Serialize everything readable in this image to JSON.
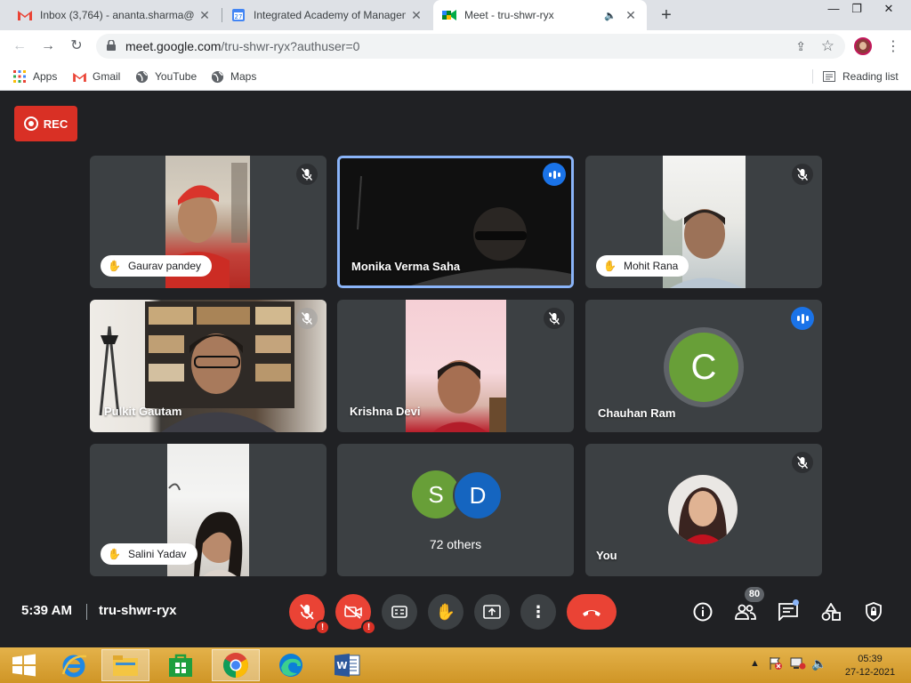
{
  "browser": {
    "tabs": [
      {
        "title": "Inbox (3,764) - ananta.sharma@i",
        "favicon": "gmail-icon"
      },
      {
        "title": "Integrated Academy of Managem",
        "favicon": "calendar-icon"
      },
      {
        "title": "Meet - tru-shwr-ryx",
        "favicon": "meet-icon",
        "active": true
      }
    ],
    "url_host": "meet.google.com",
    "url_path": "/tru-shwr-ryx?authuser=0",
    "bookmarks": [
      {
        "label": "Apps",
        "icon": "apps-grid-icon"
      },
      {
        "label": "Gmail",
        "icon": "gmail-icon"
      },
      {
        "label": "YouTube",
        "icon": "globe-icon"
      },
      {
        "label": "Maps",
        "icon": "globe-icon"
      }
    ],
    "reading_list": "Reading list"
  },
  "meet": {
    "rec_label": "REC",
    "participants": [
      {
        "name": "Gaurav pandey",
        "hand_raised": true,
        "muted": true
      },
      {
        "name": "Monika Verma Saha",
        "speaking": true
      },
      {
        "name": "Mohit Rana",
        "hand_raised": true,
        "muted": true
      },
      {
        "name": "Pulkit Gautam",
        "muted": true
      },
      {
        "name": "Krishna Devi",
        "muted": true
      },
      {
        "name": "Chauhan Ram",
        "initial": "C",
        "speaking": true
      },
      {
        "name": "Salini Yadav",
        "hand_raised": true
      },
      {
        "name": "72 others",
        "initials": [
          "S",
          "D"
        ]
      },
      {
        "name": "You",
        "muted": true
      }
    ],
    "time": "5:39 AM",
    "meeting_code": "tru-shwr-ryx",
    "people_count": "80"
  },
  "taskbar": {
    "time": "05:39",
    "date": "27-12-2021"
  },
  "colors": {
    "accent_blue": "#1a73e8",
    "danger_red": "#ea4335",
    "avatar_c": "#689f38",
    "avatar_s": "#689f38",
    "avatar_d": "#1565c0",
    "taskbar": "#d8a033"
  }
}
